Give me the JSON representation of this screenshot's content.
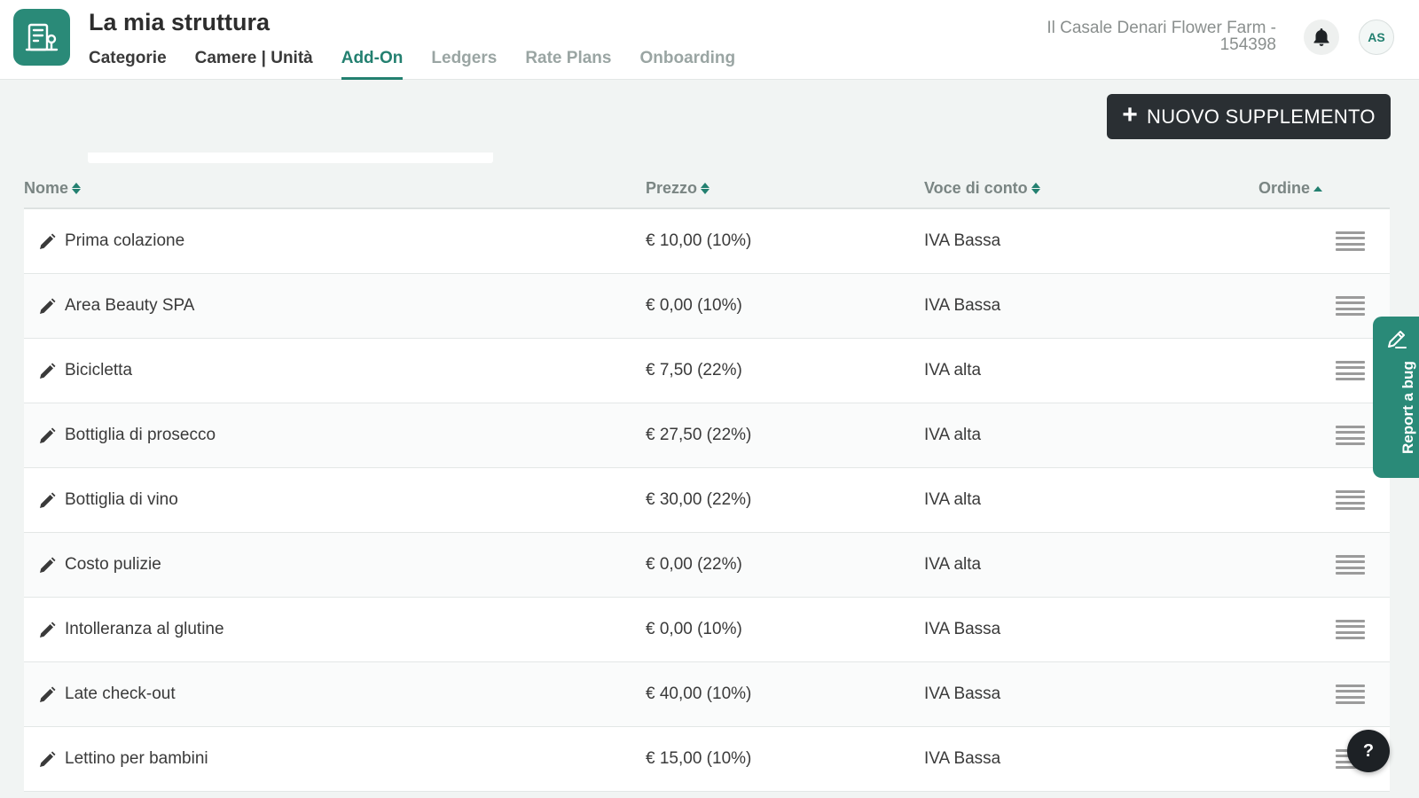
{
  "header": {
    "title": "La mia struttura",
    "property_name": "Il Casale Denari Flower Farm - 154398",
    "avatar_initials": "AS",
    "accent_color": "#2a8a78",
    "tabs": [
      {
        "label": "Categorie",
        "state": "dark"
      },
      {
        "label": "Camere | Unità",
        "state": "dark"
      },
      {
        "label": "Add-On",
        "state": "active"
      },
      {
        "label": "Ledgers",
        "state": "muted"
      },
      {
        "label": "Rate Plans",
        "state": "muted"
      },
      {
        "label": "Onboarding",
        "state": "muted"
      }
    ]
  },
  "toolbar": {
    "new_button_label": "NUOVO SUPPLEMENTO",
    "new_button_icon": "plus-icon"
  },
  "table": {
    "columns": {
      "name": "Nome",
      "price": "Prezzo",
      "ledger": "Voce di conto",
      "order": "Ordine"
    },
    "rows": [
      {
        "name": "Prima colazione",
        "price": "€ 10,00 (10%)",
        "ledger": "IVA Bassa"
      },
      {
        "name": "Area Beauty SPA",
        "price": "€ 0,00 (10%)",
        "ledger": "IVA Bassa"
      },
      {
        "name": "Bicicletta",
        "price": "€ 7,50 (22%)",
        "ledger": "IVA alta"
      },
      {
        "name": "Bottiglia di prosecco",
        "price": "€ 27,50 (22%)",
        "ledger": "IVA alta"
      },
      {
        "name": "Bottiglia di vino",
        "price": "€ 30,00 (22%)",
        "ledger": "IVA alta"
      },
      {
        "name": "Costo pulizie",
        "price": "€ 0,00 (22%)",
        "ledger": "IVA alta"
      },
      {
        "name": "Intolleranza al glutine",
        "price": "€ 0,00 (10%)",
        "ledger": "IVA Bassa"
      },
      {
        "name": "Late check-out",
        "price": "€ 40,00 (10%)",
        "ledger": "IVA Bassa"
      },
      {
        "name": "Lettino per bambini",
        "price": "€ 15,00 (10%)",
        "ledger": "IVA Bassa"
      }
    ]
  },
  "report_bug": {
    "label": "Report a bug"
  },
  "help": {
    "label": "?"
  }
}
